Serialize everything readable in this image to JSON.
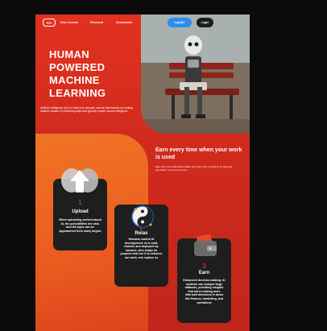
{
  "nav": {
    "logo": "AI+",
    "links": [
      "How it works",
      "Reserved",
      "Submission"
    ],
    "register": "register",
    "login": "Login"
  },
  "hero": {
    "title": "HUMAN\nPOWERED\nMACHINE\nLEARNING",
    "description": "Artificial Intelligence (AI) is a branch of computer science that focuses on creating systems capable of performing tasks that typically require human intelligence."
  },
  "earn": {
    "title": "Earn every time when your work is used",
    "description": "Earn from your submission! Each time your work is used for AI-powered generation, you earn revenue."
  },
  "cards": [
    {
      "num": "1",
      "title": "Upload",
      "text": "When uploading content about AI, the possibilities are vast, and the topic can be approached from many angles"
    },
    {
      "num": "2",
      "title": "Relax",
      "text": "Humans control AI development: AI is built, trained, and deployed by humans, who shape its purpose and use it to enhance our work, not replace us"
    },
    {
      "num": "3",
      "title": "Earn",
      "text": "Enhanced decision-making: AI systems can analyze large datasets, providing insights that aid in making more informed decisions in areas like finance, marketing, and operations"
    }
  ],
  "colors": {
    "accent": "#e2311f",
    "orange": "#f07425",
    "register": "#2d8cf0",
    "card": "#1e1e1e"
  }
}
